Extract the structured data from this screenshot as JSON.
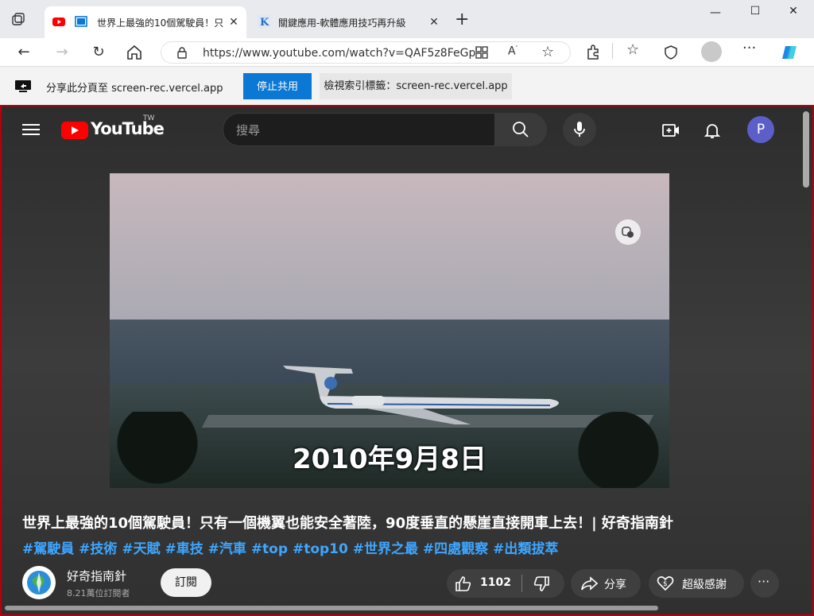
{
  "browser": {
    "tabs": [
      {
        "title": "世界上最強的10個駕駛員！只",
        "active": true
      },
      {
        "title": "關鍵應用-軟體應用技巧再升級",
        "active": false
      }
    ],
    "address": "https://www.youtube.com/watch?v=QAF5z8FeGpY",
    "share_bar": {
      "text": "分享此分頁至 screen-rec.vercel.app",
      "stop_label": "停止共用",
      "view_tab_label": "檢視索引標籤：screen-rec.vercel.app"
    }
  },
  "youtube": {
    "logo_text": "YouTube",
    "region": "TW",
    "search_placeholder": "搜尋",
    "avatar_letter": "P",
    "video": {
      "caption": "2010年9月8日"
    },
    "title": "世界上最強的10個駕駛員！只有一個機翼也能安全著陸，90度垂直的懸崖直接開車上去！| 好奇指南針",
    "hashtags": "#駕駛員 #技術 #天賦 #車技 #汽車 #top #top10 #世界之最 #四處觀察 #出類拔萃",
    "channel": {
      "name": "好奇指南針",
      "subscribers": "8.21萬位訂閱者",
      "subscribe_label": "訂閱"
    },
    "actions": {
      "like_count": "1102",
      "share_label": "分享",
      "thanks_label": "超級感謝"
    }
  },
  "colors": {
    "accent_blue": "#0a78d4",
    "youtube_red": "#ff0000",
    "hashtag_blue": "#3ea6ff",
    "share_border": "#b3000c"
  }
}
